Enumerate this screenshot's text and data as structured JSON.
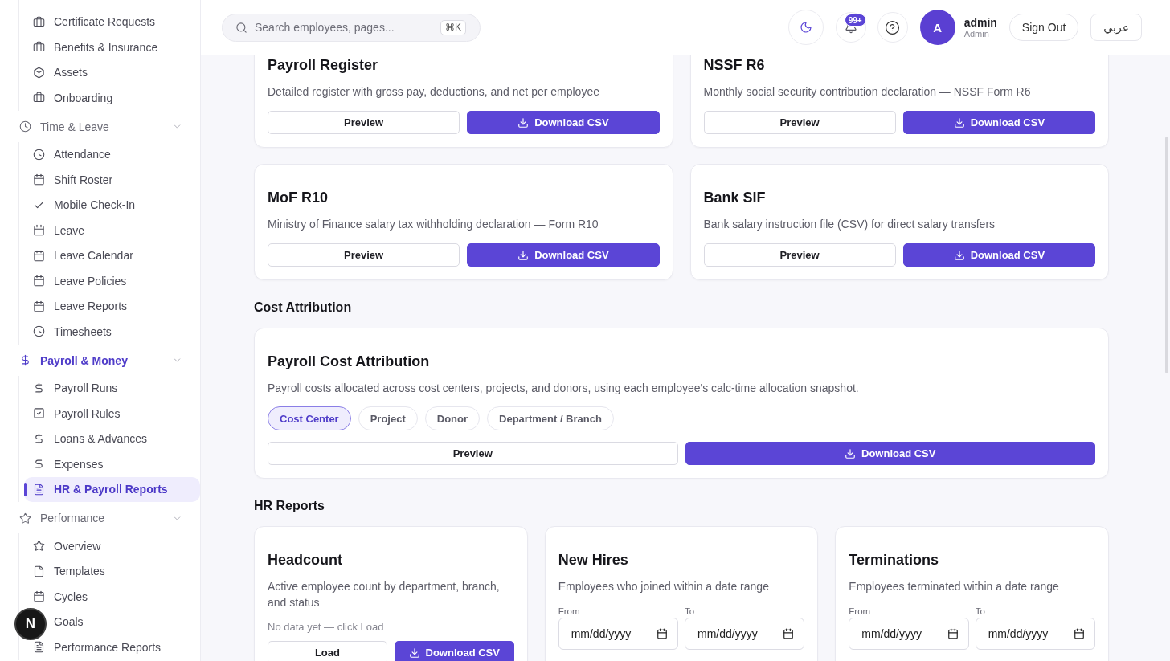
{
  "sidebar": {
    "groups": [
      {
        "items": [
          {
            "label": "Certificate Requests",
            "selected": false
          },
          {
            "label": "Benefits & Insurance",
            "selected": false
          },
          {
            "label": "Assets",
            "selected": false
          },
          {
            "label": "Onboarding",
            "selected": false
          }
        ]
      },
      {
        "label": "Time & Leave",
        "active": false,
        "expanded": true,
        "items": [
          {
            "label": "Attendance",
            "selected": false
          },
          {
            "label": "Shift Roster",
            "selected": false
          },
          {
            "label": "Mobile Check-In",
            "selected": false
          },
          {
            "label": "Leave",
            "selected": false
          },
          {
            "label": "Leave Calendar",
            "selected": false
          },
          {
            "label": "Leave Policies",
            "selected": false
          },
          {
            "label": "Leave Reports",
            "selected": false
          },
          {
            "label": "Timesheets",
            "selected": false
          }
        ]
      },
      {
        "label": "Payroll & Money",
        "active": true,
        "expanded": true,
        "items": [
          {
            "label": "Payroll Runs",
            "selected": false
          },
          {
            "label": "Payroll Rules",
            "selected": false
          },
          {
            "label": "Loans & Advances",
            "selected": false
          },
          {
            "label": "Expenses",
            "selected": false
          },
          {
            "label": "HR & Payroll Reports",
            "selected": true
          }
        ]
      },
      {
        "label": "Performance",
        "active": false,
        "expanded": true,
        "items": [
          {
            "label": "Overview",
            "selected": false
          },
          {
            "label": "Templates",
            "selected": false
          },
          {
            "label": "Cycles",
            "selected": false
          },
          {
            "label": "Goals",
            "selected": false
          },
          {
            "label": "Performance Reports",
            "selected": false
          }
        ]
      }
    ]
  },
  "header": {
    "search": {
      "placeholder": "Search employees, pages...",
      "shortcut": "⌘K"
    },
    "notifications": {
      "badge": "99+"
    },
    "user": {
      "initial": "A",
      "name": "admin",
      "role": "Admin"
    },
    "sign_out": "Sign Out",
    "language": "عربي"
  },
  "sections": [
    {
      "cards": [
        {
          "title": "Payroll Register",
          "description": "Detailed register with gross pay, deductions, and net per employee",
          "actions": [
            {
              "label": "Preview",
              "kind": "secondary"
            },
            {
              "label": "Download CSV",
              "kind": "primary"
            }
          ]
        },
        {
          "title": "NSSF R6",
          "description": "Monthly social security contribution declaration — NSSF Form R6",
          "actions": [
            {
              "label": "Preview",
              "kind": "secondary"
            },
            {
              "label": "Download CSV",
              "kind": "primary"
            }
          ]
        },
        {
          "title": "MoF R10",
          "description": "Ministry of Finance salary tax withholding declaration — Form R10",
          "actions": [
            {
              "label": "Preview",
              "kind": "secondary"
            },
            {
              "label": "Download CSV",
              "kind": "primary"
            }
          ]
        },
        {
          "title": "Bank SIF",
          "description": "Bank salary instruction file (CSV) for direct salary transfers",
          "actions": [
            {
              "label": "Preview",
              "kind": "secondary"
            },
            {
              "label": "Download CSV",
              "kind": "primary"
            }
          ]
        }
      ]
    },
    {
      "heading": "Cost Attribution",
      "cards": [
        {
          "title": "Payroll Cost Attribution",
          "description": "Payroll costs allocated across cost centers, projects, and donors, using each employee's calc-time allocation snapshot.",
          "filters": [
            {
              "label": "Cost Center",
              "selected": true
            },
            {
              "label": "Project",
              "selected": false
            },
            {
              "label": "Donor",
              "selected": false
            },
            {
              "label": "Department / Branch",
              "selected": false
            }
          ],
          "actions": [
            {
              "label": "Preview",
              "kind": "secondary"
            },
            {
              "label": "Download CSV",
              "kind": "primary"
            }
          ]
        }
      ]
    },
    {
      "heading": "HR Reports",
      "cards": [
        {
          "title": "Headcount",
          "description": "Active employee count by department, branch, and status",
          "note": "No data yet — click Load",
          "actions": [
            {
              "label": "Load",
              "kind": "secondary"
            },
            {
              "label": "Download CSV",
              "kind": "primary"
            }
          ]
        },
        {
          "title": "New Hires",
          "description": "Employees who joined within a date range",
          "date_fields": [
            {
              "label": "From",
              "placeholder": "mm/dd/yyyy"
            },
            {
              "label": "To",
              "placeholder": "mm/dd/yyyy"
            }
          ]
        },
        {
          "title": "Terminations",
          "description": "Employees terminated within a date range",
          "date_fields": [
            {
              "label": "From",
              "placeholder": "mm/dd/yyyy"
            },
            {
              "label": "To",
              "placeholder": "mm/dd/yyyy"
            }
          ]
        }
      ]
    }
  ],
  "dev_badge": {
    "label": "N"
  }
}
